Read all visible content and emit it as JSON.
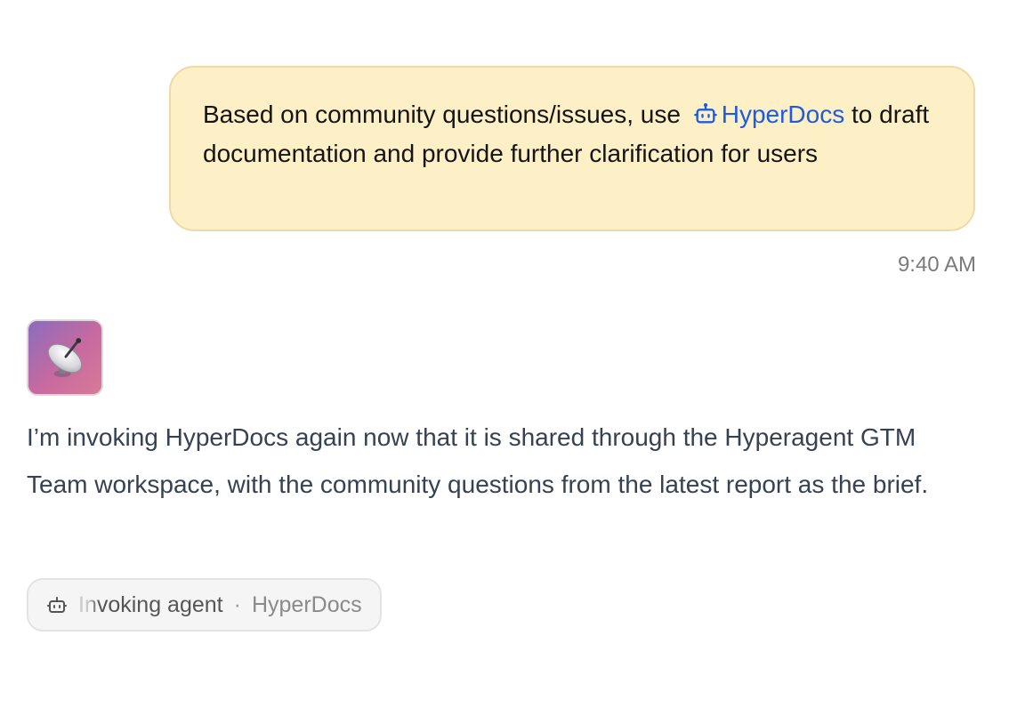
{
  "user_message": {
    "text_before": "Based on community questions/issues, use",
    "mention_label": "HyperDocs",
    "mention_icon": "bot-icon",
    "text_after": "to draft documentation and provide further clarification for users",
    "timestamp": "9:40 AM"
  },
  "assistant_message": {
    "avatar_icon": "satellite-dish-icon",
    "text": "I’m invoking HyperDocs again now that it is shared through the Hyperagent GTM Team workspace, with the community questions from the latest report as the brief."
  },
  "status_chip": {
    "icon": "bot-icon",
    "action": "Invoking agent",
    "separator": "·",
    "agent": "HyperDocs"
  },
  "colors": {
    "user_bubble_bg": "#fdefc6",
    "mention": "#1f5be0",
    "assistant_text": "#374151"
  }
}
